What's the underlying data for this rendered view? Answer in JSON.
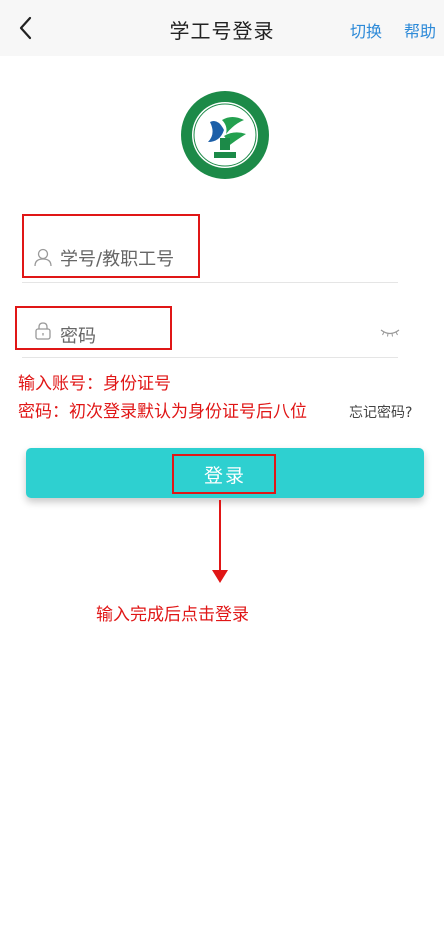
{
  "header": {
    "title": "学工号登录",
    "switch_label": "切换",
    "help_label": "帮助"
  },
  "logo": {
    "description_icon": "school-emblem-icon"
  },
  "form": {
    "account_placeholder": "学号/教职工号",
    "password_placeholder": "密码",
    "forgot_label": "忘记密码?",
    "login_label": "登录"
  },
  "annotations": {
    "note_account": "输入账号：身份证号",
    "note_password": "密码：初次登录默认为身份证号后八位",
    "note_login": "输入完成后点击登录"
  },
  "colors": {
    "accent": "#2ed0d0",
    "link": "#2d8ad8",
    "annotation_red": "#e01616"
  }
}
